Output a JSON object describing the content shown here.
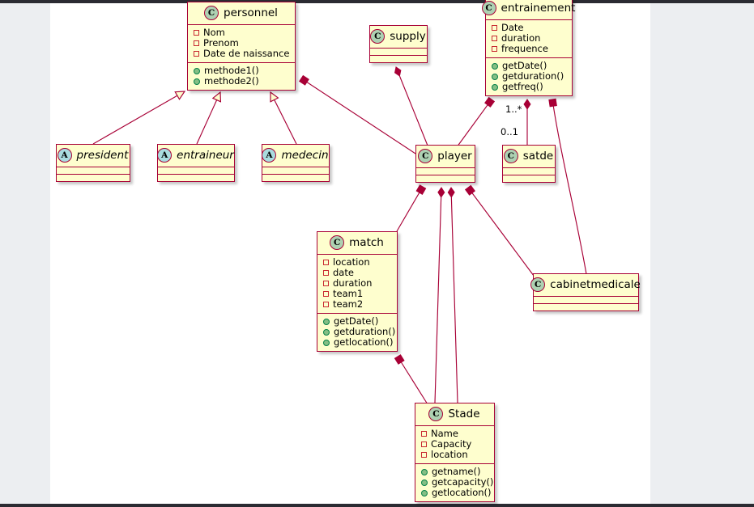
{
  "diagram": {
    "kind": "uml-class-diagram",
    "colors": {
      "class_body": "#FEFECE",
      "class_border": "#A80036",
      "class_badge": "#ADD1B2",
      "abstract_badge": "#A9DCDF",
      "field_marker": "#C82930",
      "method_marker": "#84BE84",
      "line": "#A80036",
      "canvas": "#FFFFFF",
      "page_gutter": "#ECEEF1",
      "chrome_bar": "#2B2B32"
    },
    "classes": [
      {
        "id": "personnel",
        "name": "personnel",
        "stereotype": "C",
        "abstract": false,
        "fields": [
          "Nom",
          "Prenom",
          "Date de naissance"
        ],
        "methods": [
          "methode1()",
          "methode2()"
        ]
      },
      {
        "id": "supply",
        "name": "supply",
        "stereotype": "C",
        "abstract": false,
        "fields": [],
        "methods": []
      },
      {
        "id": "entrainement",
        "name": "entrainement",
        "stereotype": "C",
        "abstract": false,
        "fields": [
          "Date",
          "duration",
          "frequence"
        ],
        "methods": [
          "getDate()",
          "getduration()",
          "getfreq()"
        ]
      },
      {
        "id": "president",
        "name": "president",
        "stereotype": "A",
        "abstract": true,
        "fields": [],
        "methods": []
      },
      {
        "id": "entraineur",
        "name": "entraineur",
        "stereotype": "A",
        "abstract": true,
        "fields": [],
        "methods": []
      },
      {
        "id": "medecin",
        "name": "medecin",
        "stereotype": "A",
        "abstract": true,
        "fields": [],
        "methods": []
      },
      {
        "id": "player",
        "name": "player",
        "stereotype": "C",
        "abstract": false,
        "fields": [],
        "methods": []
      },
      {
        "id": "satde",
        "name": "satde",
        "stereotype": "C",
        "abstract": false,
        "fields": [],
        "methods": []
      },
      {
        "id": "match",
        "name": "match",
        "stereotype": "C",
        "abstract": false,
        "fields": [
          "location",
          "date",
          "duration",
          "team1",
          "team2"
        ],
        "methods": [
          "getDate()",
          "getduration()",
          "getlocation()"
        ]
      },
      {
        "id": "cabinetmedicale",
        "name": "cabinetmedicale",
        "stereotype": "C",
        "abstract": false,
        "fields": [],
        "methods": []
      },
      {
        "id": "Stade",
        "name": "Stade",
        "stereotype": "C",
        "abstract": false,
        "fields": [
          "Name",
          "Capacity",
          "location"
        ],
        "methods": [
          "getname()",
          "getcapacity()",
          "getlocation()"
        ]
      }
    ],
    "edge_labels": [
      {
        "id": "mult-one-to-many",
        "text": "1..*"
      },
      {
        "id": "mult-zero-to-one",
        "text": "0..1"
      }
    ],
    "relations": [
      {
        "from": "president",
        "to": "personnel",
        "type": "generalization"
      },
      {
        "from": "entraineur",
        "to": "personnel",
        "type": "generalization"
      },
      {
        "from": "medecin",
        "to": "personnel",
        "type": "generalization"
      },
      {
        "from": "personnel",
        "to": "player",
        "type": "composition"
      },
      {
        "from": "supply",
        "to": "player",
        "type": "composition"
      },
      {
        "from": "entrainement",
        "to": "player",
        "type": "composition"
      },
      {
        "from": "entrainement",
        "to": "satde",
        "type": "composition"
      },
      {
        "from": "entrainement",
        "to": "cabinetmedicale",
        "type": "composition"
      },
      {
        "from": "player",
        "to": "match",
        "type": "composition"
      },
      {
        "from": "player",
        "to": "Stade",
        "type": "composition"
      },
      {
        "from": "player",
        "to": "cabinetmedicale",
        "type": "composition"
      },
      {
        "from": "match",
        "to": "Stade",
        "type": "composition"
      }
    ]
  }
}
